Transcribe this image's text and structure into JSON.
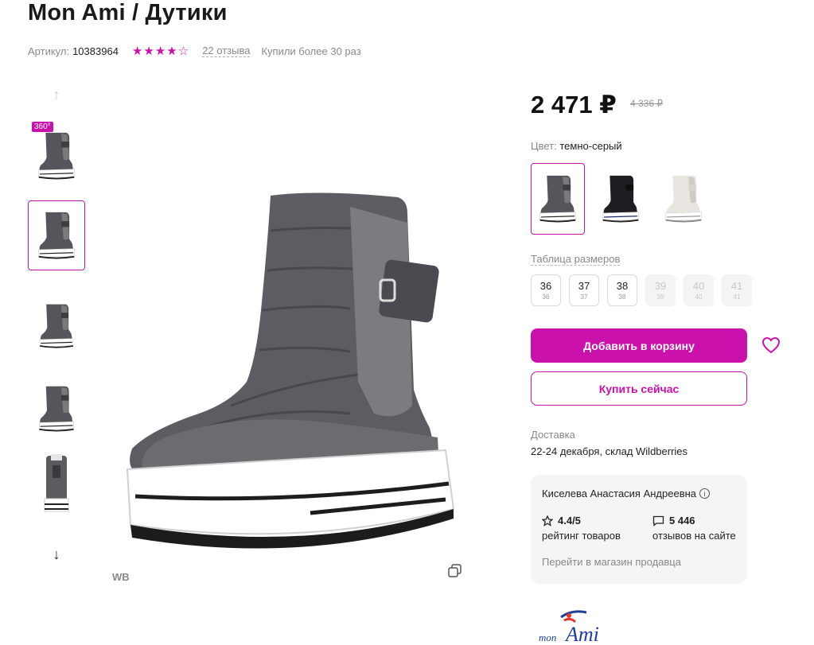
{
  "product": {
    "title": "Mon Ami / Дутики",
    "article_label": "Артикул:",
    "article_value": "10383964",
    "rating_stars": 4,
    "rating_max": 5,
    "reviews_link": "22 отзыва",
    "bought_text": "Купили более 30 раз"
  },
  "gallery": {
    "badge_360": "360°",
    "up_arrow_icon": "arrow-up-icon",
    "down_arrow_icon": "arrow-down-icon",
    "wb_label": "WB",
    "zoom_icon": "zoom-copy-icon"
  },
  "price": {
    "current": "2 471 ₽",
    "old": "4 336 ₽"
  },
  "color": {
    "label": "Цвет:",
    "value": "темно-серый",
    "options": [
      "темно-серый",
      "черный",
      "светло-серый"
    ]
  },
  "sizes": {
    "label": "Таблица размеров",
    "items": [
      {
        "main": "36",
        "sub": "36",
        "available": true
      },
      {
        "main": "37",
        "sub": "37",
        "available": true
      },
      {
        "main": "38",
        "sub": "38",
        "available": true
      },
      {
        "main": "39",
        "sub": "39",
        "available": false
      },
      {
        "main": "40",
        "sub": "40",
        "available": false
      },
      {
        "main": "41",
        "sub": "41",
        "available": false
      }
    ]
  },
  "actions": {
    "add_to_cart": "Добавить в корзину",
    "buy_now": "Купить сейчас",
    "favorite_icon": "heart-icon"
  },
  "delivery": {
    "label": "Доставка",
    "value": "22-24 декабря, склад Wildberries"
  },
  "seller": {
    "name": "Киселева Анастасия Андреевна",
    "rating_value": "4.4/5",
    "rating_caption": "рейтинг товаров",
    "reviews_value": "5 446",
    "reviews_caption": "отзывов на сайте",
    "store_link": "Перейти в магазин продавца"
  },
  "brand": {
    "logo_text_small": "mon",
    "logo_text_big": "Ami"
  },
  "colors": {
    "accent": "#cb11ab",
    "text_muted": "#888888",
    "panel_bg": "#f5f5f6"
  }
}
